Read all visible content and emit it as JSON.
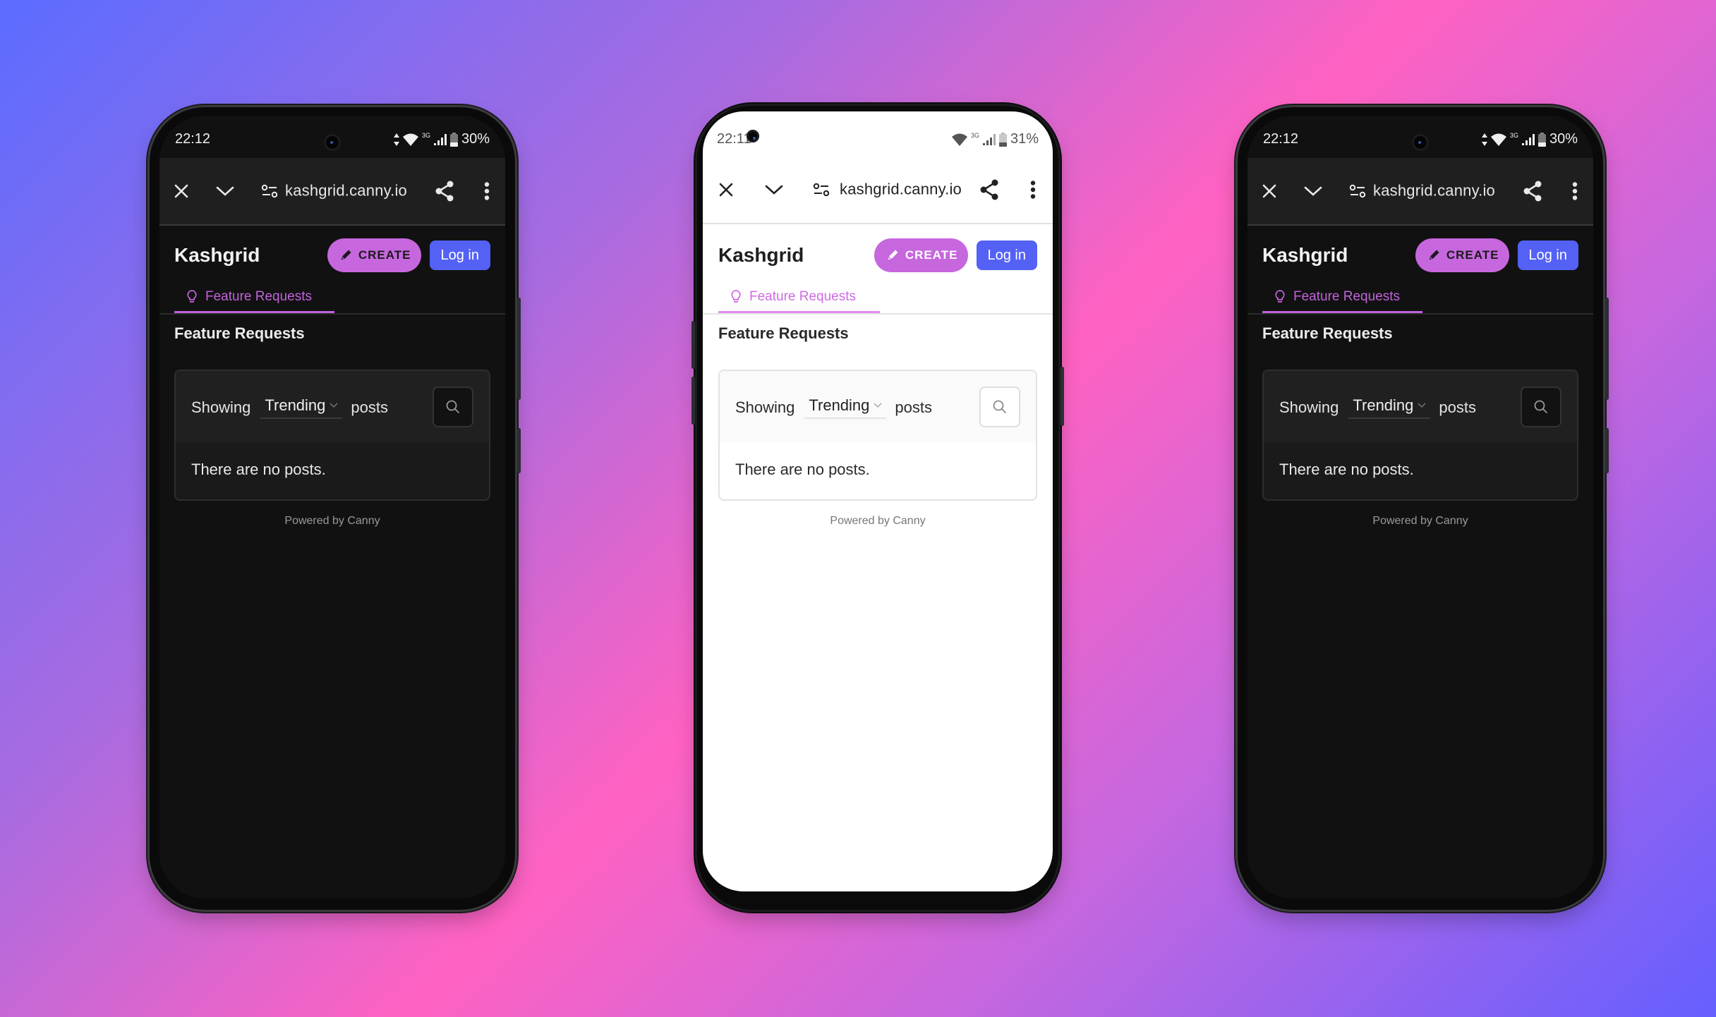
{
  "colors": {
    "background_gradient": [
      "#5b6cff",
      "#ff62c2",
      "#655fff"
    ],
    "create_button": "#c767de",
    "login_button": "#5461f5",
    "tab_accent": "#c262dc",
    "dark_screen": "#111111",
    "light_screen": "#ffffff"
  },
  "phones": [
    {
      "theme": "dark",
      "status": {
        "time": "22:12",
        "network": "3G",
        "battery": "30%",
        "icons": [
          "data-arrows-icon",
          "wifi-icon",
          "signal-icon",
          "battery-icon"
        ]
      },
      "browser": {
        "url": "kashgrid.canny.io",
        "icons": [
          "close-icon",
          "chevron-down-icon",
          "site-settings-icon",
          "share-icon",
          "more-vert-icon"
        ]
      },
      "header": {
        "brand": "Kashgrid",
        "create_label": "CREATE",
        "login_label": "Log in"
      },
      "tabs": [
        {
          "label": "Feature Requests",
          "icon": "lightbulb-icon",
          "active": true
        }
      ],
      "section_title": "Feature Requests",
      "filter": {
        "prefix": "Showing",
        "sort_value": "Trending",
        "suffix": "posts"
      },
      "empty_message": "There are no posts.",
      "footer": "Powered by Canny"
    },
    {
      "theme": "light",
      "status": {
        "time": "22:11",
        "network": "3G",
        "battery": "31%",
        "icons": [
          "wifi-icon",
          "signal-icon",
          "battery-icon"
        ]
      },
      "browser": {
        "url": "kashgrid.canny.io",
        "icons": [
          "close-icon",
          "chevron-down-icon",
          "site-settings-icon",
          "share-icon",
          "more-vert-icon"
        ]
      },
      "header": {
        "brand": "Kashgrid",
        "create_label": "CREATE",
        "login_label": "Log in"
      },
      "tabs": [
        {
          "label": "Feature Requests",
          "icon": "lightbulb-icon",
          "active": true
        }
      ],
      "section_title": "Feature Requests",
      "filter": {
        "prefix": "Showing",
        "sort_value": "Trending",
        "suffix": "posts"
      },
      "empty_message": "There are no posts.",
      "footer": "Powered by Canny"
    },
    {
      "theme": "dark",
      "status": {
        "time": "22:12",
        "network": "3G",
        "battery": "30%",
        "icons": [
          "data-arrows-icon",
          "wifi-icon",
          "signal-icon",
          "battery-icon"
        ]
      },
      "browser": {
        "url": "kashgrid.canny.io",
        "icons": [
          "close-icon",
          "chevron-down-icon",
          "site-settings-icon",
          "share-icon",
          "more-vert-icon"
        ]
      },
      "header": {
        "brand": "Kashgrid",
        "create_label": "CREATE",
        "login_label": "Log in"
      },
      "tabs": [
        {
          "label": "Feature Requests",
          "icon": "lightbulb-icon",
          "active": true
        }
      ],
      "section_title": "Feature Requests",
      "filter": {
        "prefix": "Showing",
        "sort_value": "Trending",
        "suffix": "posts"
      },
      "empty_message": "There are no posts.",
      "footer": "Powered by Canny"
    }
  ]
}
